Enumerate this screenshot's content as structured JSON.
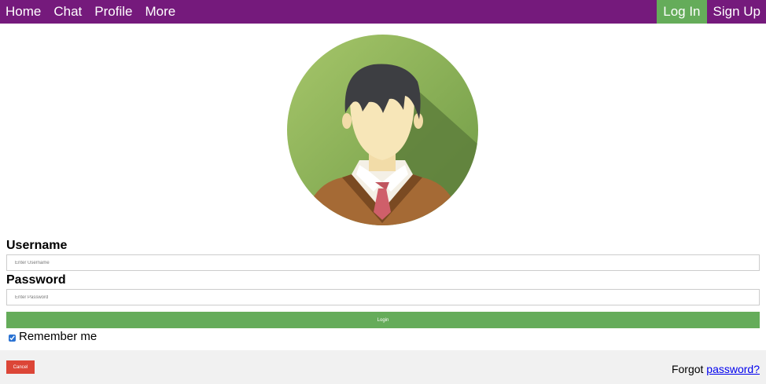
{
  "colors": {
    "navbar": "#751a7c",
    "accent_green": "#65ac5a",
    "cancel_red": "#dc4637",
    "footer_bg": "#f1f1f1",
    "link": "#0000ee"
  },
  "nav": {
    "left": [
      {
        "label": "Home"
      },
      {
        "label": "Chat"
      },
      {
        "label": "Profile"
      },
      {
        "label": "More"
      }
    ],
    "login_label": "Log In",
    "signup_label": "Sign Up"
  },
  "avatar": {
    "icon": "user-avatar-icon"
  },
  "form": {
    "username_label": "Username",
    "username_placeholder": "Enter Username",
    "password_label": "Password",
    "password_placeholder": "Enter Password",
    "login_button": "Login",
    "remember_label": "Remember me",
    "remember_checked": true
  },
  "footer": {
    "cancel_button": "Cancel",
    "forgot_prefix": "Forgot",
    "forgot_link": "password?"
  }
}
